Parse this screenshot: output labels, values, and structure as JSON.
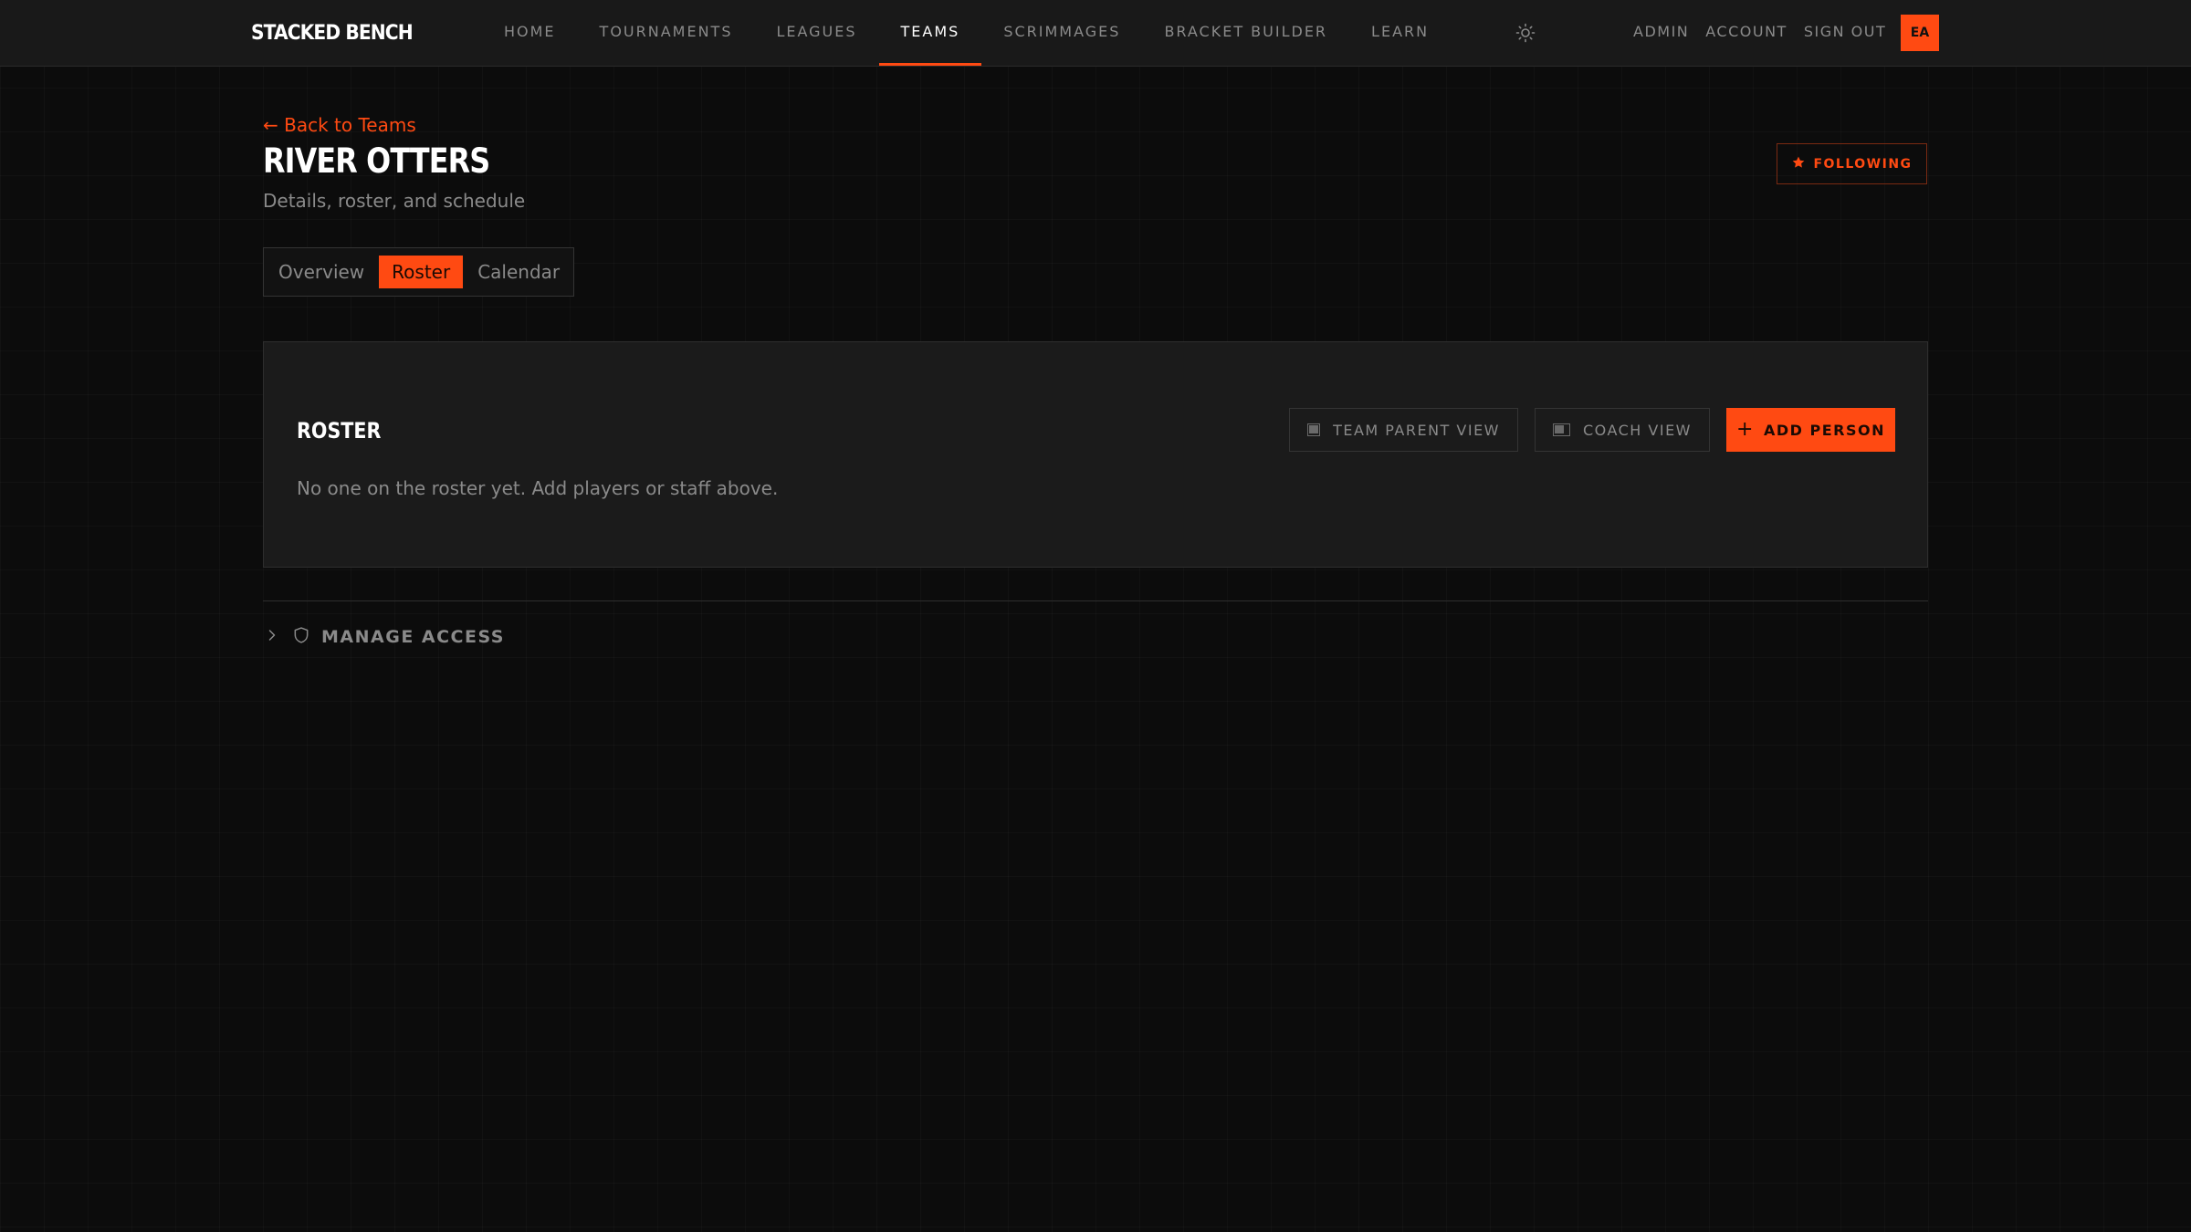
{
  "brand": "STACKED BENCH",
  "nav": {
    "items": [
      "HOME",
      "TOURNAMENTS",
      "LEAGUES",
      "TEAMS",
      "SCRIMMAGES",
      "BRACKET BUILDER",
      "LEARN"
    ],
    "active": "TEAMS"
  },
  "user_nav": {
    "admin": "ADMIN",
    "account": "ACCOUNT",
    "sign_out": "SIGN OUT",
    "avatar_initials": "EA"
  },
  "header": {
    "back_link": "← Back to Teams",
    "title": "RIVER OTTERS",
    "subtitle": "Details, roster, and schedule",
    "follow_label": "FOLLOWING"
  },
  "tabs": {
    "items": [
      "Overview",
      "Roster",
      "Calendar"
    ],
    "active": "Roster"
  },
  "roster": {
    "title": "ROSTER",
    "empty_message": "No one on the roster yet. Add players or staff above.",
    "team_parent_view_label": "TEAM PARENT VIEW",
    "coach_view_label": "COACH VIEW",
    "add_person_label": "ADD PERSON"
  },
  "manage_access": {
    "label": "MANAGE ACCESS"
  },
  "colors": {
    "accent": "#ff4a12",
    "background": "#0c0c0c",
    "surface": "#1b1b1b",
    "muted_text": "#8a8a8a"
  },
  "icons": {
    "theme_toggle": "sun-icon",
    "follow": "star-icon",
    "view_toggle": "toggle-icon",
    "add": "plus-icon",
    "expand": "chevron-right-icon",
    "access": "shield-icon"
  }
}
